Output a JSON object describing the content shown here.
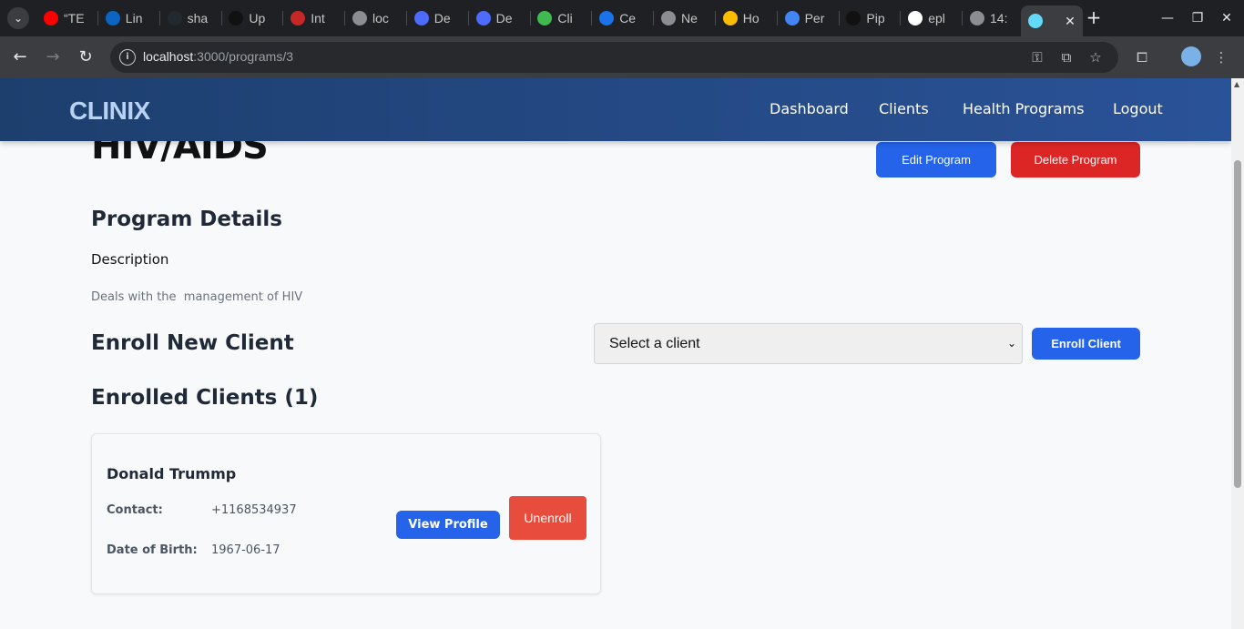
{
  "browser": {
    "tabs": [
      {
        "label": "“TE",
        "icon": "youtube-icon",
        "color": "#ff0000"
      },
      {
        "label": "Lin",
        "icon": "linkedin-icon",
        "color": "#0a66c2"
      },
      {
        "label": "sha",
        "icon": "github-icon",
        "color": "#24292f"
      },
      {
        "label": "Up",
        "icon": "openai-icon",
        "color": "#111111"
      },
      {
        "label": "Int",
        "icon": "gauge-icon",
        "color": "#c62828"
      },
      {
        "label": "loc",
        "icon": "globe-icon",
        "color": "#8a8d91"
      },
      {
        "label": "De",
        "icon": "deepseek-icon",
        "color": "#4d6bfe"
      },
      {
        "label": "De",
        "icon": "deepseek-icon",
        "color": "#4d6bfe"
      },
      {
        "label": "Cli",
        "icon": "green-circle-icon",
        "color": "#3fb950"
      },
      {
        "label": "Ce",
        "icon": "blue-arc-icon",
        "color": "#1a73e8"
      },
      {
        "label": "Ne",
        "icon": "chrome-icon",
        "color": "#8a8d91"
      },
      {
        "label": "Ho",
        "icon": "drive-icon",
        "color": "#fbbc04"
      },
      {
        "label": "Per",
        "icon": "docs-icon",
        "color": "#4285f4"
      },
      {
        "label": "Pip",
        "icon": "openai-icon",
        "color": "#111111"
      },
      {
        "label": "epl",
        "icon": "google-icon",
        "color": "#ffffff"
      },
      {
        "label": "14:",
        "icon": "globe-icon",
        "color": "#8a8d91"
      },
      {
        "label": "",
        "icon": "react-icon",
        "color": "#61dafb",
        "active": true
      }
    ],
    "url_host": "localhost",
    "url_path": ":3000/programs/3"
  },
  "app": {
    "brand": "CLINIX",
    "nav": [
      "Dashboard",
      "Clients",
      "Health Programs",
      "Logout"
    ]
  },
  "program": {
    "title": "HIV/AIDS",
    "edit_label": "Edit Program",
    "delete_label": "Delete Program",
    "details_heading": "Program Details",
    "description_label": "Description",
    "description": "Deals with the  management of HIV"
  },
  "enroll": {
    "heading": "Enroll New Client",
    "select_value": "Select a client",
    "button_label": "Enroll Client"
  },
  "enrolled": {
    "heading": "Enrolled Clients (1)",
    "clients": [
      {
        "name": "Donald Trummp",
        "contact_label": "Contact:",
        "contact": "+1168534937",
        "dob_label": "Date of Birth:",
        "dob": "1967-06-17",
        "view_label": "View Profile",
        "unenroll_label": "Unenroll"
      }
    ]
  },
  "colors": {
    "header_start": "#1d3f6e",
    "header_end": "#2a5298",
    "primary": "#2563eb",
    "danger": "#dc2626",
    "unenroll": "#e74c3c"
  }
}
